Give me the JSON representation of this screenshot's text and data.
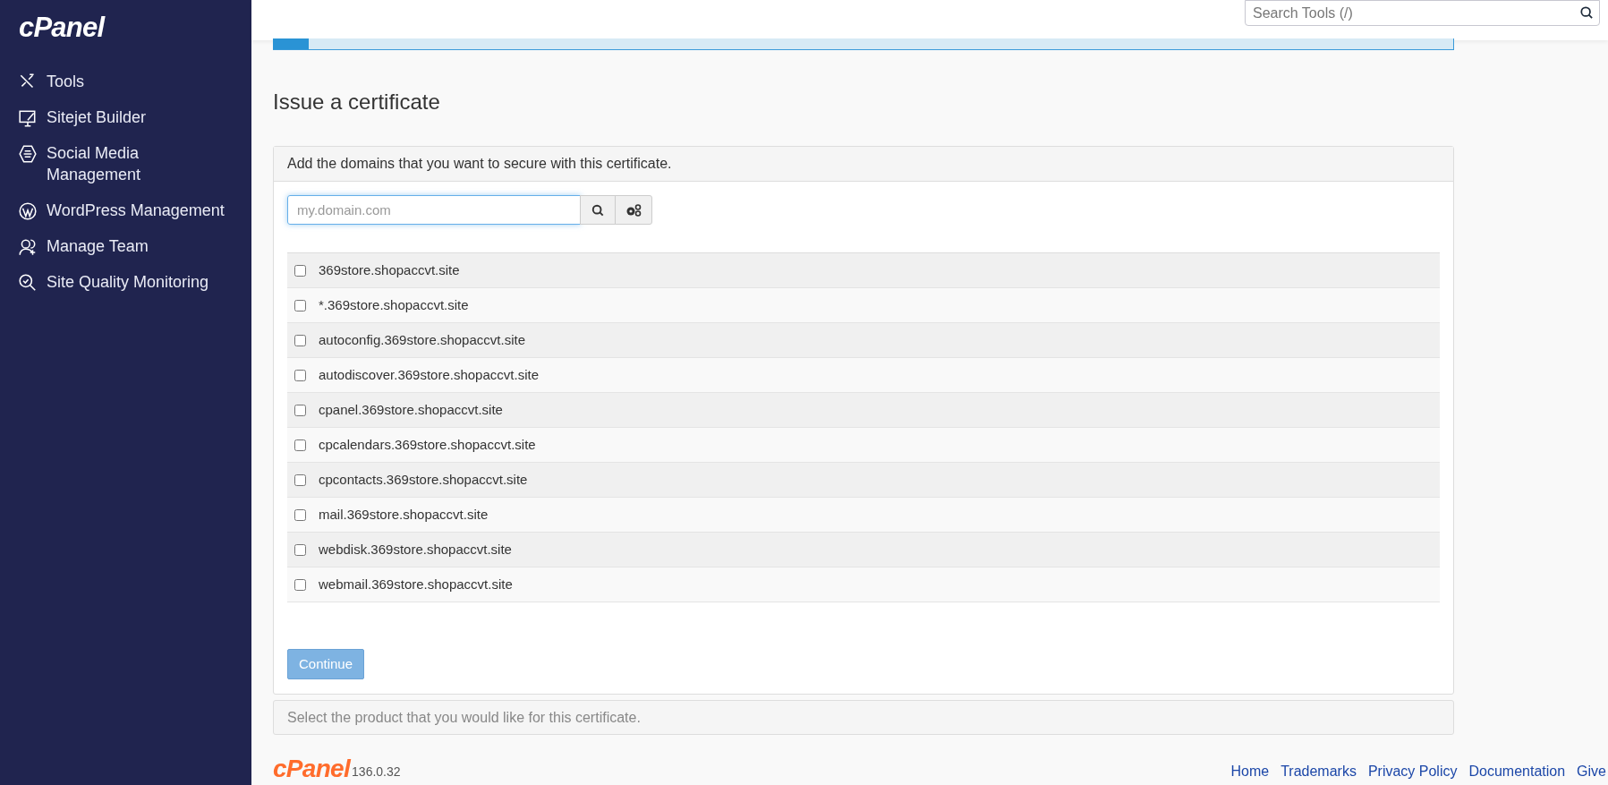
{
  "sidebar": {
    "logo": "cPanel",
    "items": [
      {
        "label": "Tools"
      },
      {
        "label": "Sitejet Builder"
      },
      {
        "label": "Social Media\nManagement"
      },
      {
        "label": "WordPress Management"
      },
      {
        "label": "Manage Team"
      },
      {
        "label": "Site Quality Monitoring"
      }
    ]
  },
  "search": {
    "placeholder": "Search Tools (/)"
  },
  "page": {
    "title": "Issue a certificate",
    "domains_panel": {
      "heading": "Add the domains that you want to secure with this certificate.",
      "input_placeholder": "my.domain.com",
      "domains": [
        {
          "name": "369store.shopaccvt.site",
          "checked": false
        },
        {
          "name": "*.369store.shopaccvt.site",
          "checked": false
        },
        {
          "name": "autoconfig.369store.shopaccvt.site",
          "checked": false
        },
        {
          "name": "autodiscover.369store.shopaccvt.site",
          "checked": false
        },
        {
          "name": "cpanel.369store.shopaccvt.site",
          "checked": false
        },
        {
          "name": "cpcalendars.369store.shopaccvt.site",
          "checked": false
        },
        {
          "name": "cpcontacts.369store.shopaccvt.site",
          "checked": false
        },
        {
          "name": "mail.369store.shopaccvt.site",
          "checked": false
        },
        {
          "name": "webdisk.369store.shopaccvt.site",
          "checked": false
        },
        {
          "name": "webmail.369store.shopaccvt.site",
          "checked": false
        }
      ],
      "button": "Continue"
    },
    "product_panel": {
      "heading": "Select the product that you would like for this certificate."
    }
  },
  "footer": {
    "logo": "cPanel",
    "version": "136.0.32",
    "links": [
      "Home",
      "Trademarks",
      "Privacy Policy",
      "Documentation",
      "Give"
    ]
  }
}
